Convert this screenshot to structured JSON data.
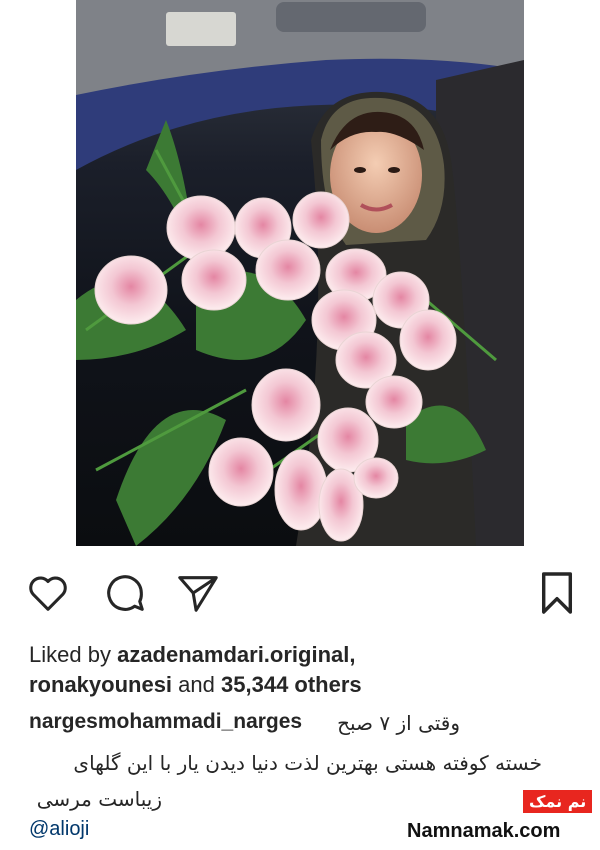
{
  "post": {
    "liked_by_prefix": "Liked by",
    "liked_by_user": "azadenamdari.original,",
    "liked_by_user2": "ronakyounesi",
    "liked_by_and": "and",
    "liked_count": "35,344 others",
    "author": "nargesmohammadi_narges",
    "caption_line1": "وقتی از ۷ صبح",
    "caption_line2": "خسته کوفته هستی بهترین لذت دنیا دیدن یار با این گلهای",
    "caption_line3": "زیباست مرسی",
    "mention": "@alioji"
  },
  "actions": {
    "like": "heart-icon",
    "comment": "comment-icon",
    "share": "share-icon",
    "save": "bookmark-icon"
  },
  "watermark": {
    "fa": "نم نمک",
    "en": "Namnamak.com"
  }
}
